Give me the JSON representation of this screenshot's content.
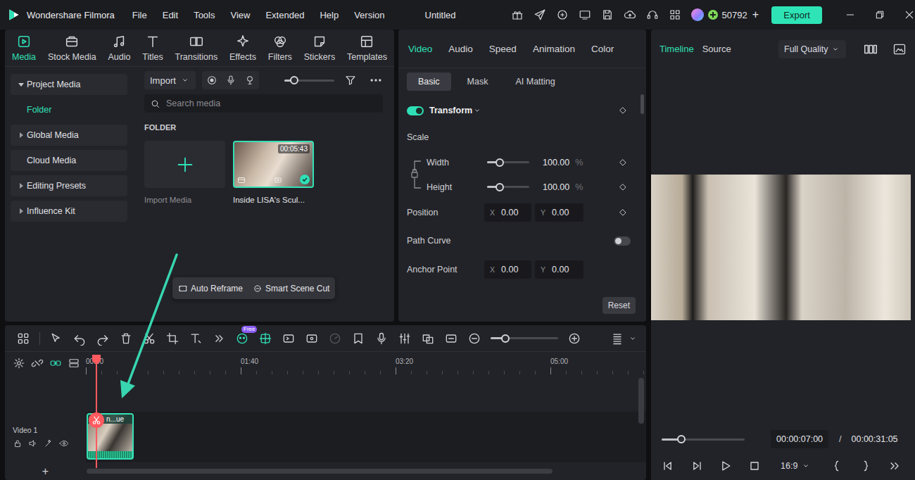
{
  "window": {
    "app_name": "Wondershare Filmora",
    "menu": [
      "File",
      "Edit",
      "Tools",
      "View",
      "Extended",
      "Help",
      "Version"
    ],
    "title": "Untitled",
    "credits": "50792",
    "credits_add": "+",
    "export": "Export"
  },
  "media_tabs": [
    {
      "label": "Media",
      "selected": true
    },
    {
      "label": "Stock Media",
      "selected": false
    },
    {
      "label": "Audio",
      "selected": false
    },
    {
      "label": "Titles",
      "selected": false
    },
    {
      "label": "Transitions",
      "selected": false
    },
    {
      "label": "Effects",
      "selected": false
    },
    {
      "label": "Filters",
      "selected": false
    },
    {
      "label": "Stickers",
      "selected": false
    },
    {
      "label": "Templates",
      "selected": false
    }
  ],
  "sidebar": {
    "items": [
      {
        "label": "Project Media",
        "kind": "group",
        "expanded": true,
        "selected": false
      },
      {
        "label": "Folder",
        "kind": "child",
        "expanded": false,
        "selected": true
      },
      {
        "label": "Global Media",
        "kind": "group",
        "expanded": false,
        "selected": false
      },
      {
        "label": "Cloud Media",
        "kind": "link",
        "expanded": false,
        "selected": false
      },
      {
        "label": "Editing Presets",
        "kind": "group",
        "expanded": false,
        "selected": false
      },
      {
        "label": "Influence Kit",
        "kind": "group",
        "expanded": false,
        "selected": false
      }
    ]
  },
  "media_toolbar": {
    "import": "Import",
    "zoom_level": 0.2
  },
  "search": {
    "placeholder": "Search media"
  },
  "folder_label": "FOLDER",
  "media_items": [
    {
      "kind": "import",
      "label": "Import Media",
      "selected": false
    },
    {
      "kind": "clip",
      "label": "Inside LISA's Scul...",
      "duration": "00:05:43",
      "selected": true
    }
  ],
  "context_menu": [
    "Auto Reframe",
    "Smart Scene Cut"
  ],
  "properties": {
    "tabs": [
      {
        "label": "Video",
        "selected": true
      },
      {
        "label": "Audio",
        "selected": false
      },
      {
        "label": "Speed",
        "selected": false
      },
      {
        "label": "Animation",
        "selected": false
      },
      {
        "label": "Color",
        "selected": false
      }
    ],
    "subtabs": [
      {
        "label": "Basic",
        "selected": true
      },
      {
        "label": "Mask",
        "selected": false
      },
      {
        "label": "AI Matting",
        "selected": false
      }
    ],
    "transform": {
      "label": "Transform",
      "on": true
    },
    "scale_label": "Scale",
    "scale_rows": [
      {
        "label": "Width",
        "level": 0.3,
        "value": "100.00",
        "unit": "%"
      },
      {
        "label": "Height",
        "level": 0.3,
        "value": "100.00",
        "unit": "%"
      }
    ],
    "position": {
      "label": "Position",
      "x_label": "X",
      "x": "0.00",
      "y_label": "Y",
      "y": "0.00"
    },
    "path_curve": {
      "label": "Path Curve",
      "on": false
    },
    "anchor_point": {
      "label": "Anchor Point",
      "x_label": "X",
      "x": "0.00",
      "y_label": "Y",
      "y": "0.00"
    },
    "reset": "Reset"
  },
  "player": {
    "tabs": [
      {
        "label": "Timeline",
        "selected": true
      },
      {
        "label": "Source",
        "selected": false
      }
    ],
    "quality": "Full Quality",
    "progress_level": 0.24,
    "current_time": "00:00:07:00",
    "separator": "/",
    "total_time": "00:00:31:05",
    "aspect": "16:9"
  },
  "timeline": {
    "toolbar_badge": "Free",
    "zoom_level": 0.22,
    "ruler": [
      "00:00",
      "01:40",
      "03:20",
      "05:00"
    ],
    "track": {
      "label": "Video 1"
    },
    "clip": {
      "label": "n...ue"
    },
    "add_track": "+"
  }
}
